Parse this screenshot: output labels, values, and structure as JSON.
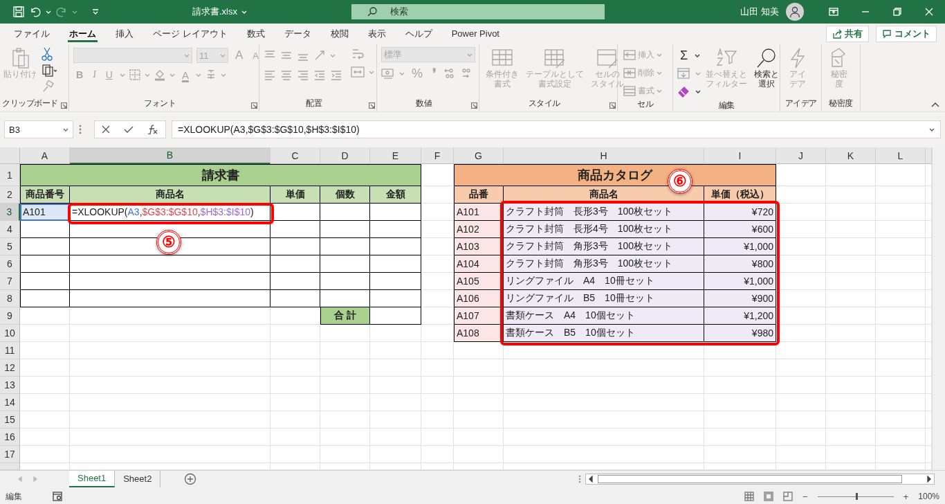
{
  "title_bar": {
    "file_name": "請求書.xlsx",
    "search": {
      "placeholder": "検索"
    },
    "user": "山田 知美"
  },
  "ribbon_tabs": [
    {
      "label": "ファイル",
      "selected": false
    },
    {
      "label": "ホーム",
      "selected": true
    },
    {
      "label": "挿入",
      "selected": false
    },
    {
      "label": "ページ レイアウト",
      "selected": false
    },
    {
      "label": "数式",
      "selected": false
    },
    {
      "label": "データ",
      "selected": false
    },
    {
      "label": "校閲",
      "selected": false
    },
    {
      "label": "表示",
      "selected": false
    },
    {
      "label": "ヘルプ",
      "selected": false
    },
    {
      "label": "Power Pivot",
      "selected": false
    }
  ],
  "share_button": "共有",
  "comment_button": "コメント",
  "ribbon_groups": [
    {
      "kind": "clipboard",
      "label": "クリップボード",
      "buttons": [
        {
          "label_lines": [
            "貼り付け"
          ],
          "disabled": true
        }
      ]
    },
    {
      "kind": "font",
      "label": "フォント",
      "size": "11",
      "buttons": [
        {
          "label": "A",
          "disabled": true
        },
        {
          "label": "A",
          "disabled": true
        },
        {
          "label": "B",
          "disabled": true
        },
        {
          "label": "I",
          "disabled": true
        },
        {
          "label": "U",
          "disabled": true
        },
        {
          "label": "A",
          "disabled": true
        }
      ]
    },
    {
      "kind": "alignment",
      "label": "配置"
    },
    {
      "kind": "number",
      "label": "数値",
      "format": "標準",
      "buttons": [
        {
          "label": "%",
          "disabled": true
        },
        {
          "label": "❜",
          "disabled": true
        }
      ]
    },
    {
      "kind": "styles",
      "label": "スタイル",
      "buttons": [
        {
          "label_lines": [
            "条件付き",
            "書式"
          ],
          "disabled": true
        },
        {
          "label_lines": [
            "テーブルとして",
            "書式設定"
          ],
          "disabled": true
        },
        {
          "label_lines": [
            "セルの",
            "スタイル"
          ],
          "disabled": true
        }
      ]
    },
    {
      "kind": "cells",
      "label": "セル",
      "buttons": [
        {
          "label": "挿入",
          "disabled": true
        },
        {
          "label": "削除",
          "disabled": true
        },
        {
          "label": "書式",
          "disabled": true
        }
      ]
    },
    {
      "kind": "editing",
      "label": "編集",
      "buttons": [
        {
          "label": "Σ",
          "disabled": false
        },
        {
          "label_lines": [
            "並べ替えと",
            "フィルター"
          ],
          "disabled": true
        },
        {
          "label_lines": [
            "検索と",
            "選択"
          ],
          "disabled": false
        }
      ]
    },
    {
      "kind": "ideas",
      "label": "アイデア",
      "buttons": [
        {
          "label_lines": [
            "アイ",
            "デア"
          ],
          "disabled": true
        }
      ]
    },
    {
      "kind": "sensitivity",
      "label": "秘密度",
      "buttons": [
        {
          "label_lines": [
            "秘密",
            "度"
          ],
          "disabled": true
        }
      ]
    }
  ],
  "formula_bar": {
    "name_box": "B3",
    "formula": "=XLOOKUP(A3,$G$3:$G$10,$H$3:$I$10)"
  },
  "sheet": {
    "columns": [
      {
        "label": "A",
        "selected": false
      },
      {
        "label": "B",
        "selected": true
      },
      {
        "label": "C",
        "selected": false
      },
      {
        "label": "D",
        "selected": false
      },
      {
        "label": "E",
        "selected": false
      },
      {
        "label": "F",
        "selected": false
      },
      {
        "label": "G",
        "selected": false
      },
      {
        "label": "H",
        "selected": false
      },
      {
        "label": "I",
        "selected": false
      },
      {
        "label": "J",
        "selected": false
      },
      {
        "label": "K",
        "selected": false
      },
      {
        "label": "L",
        "selected": false
      }
    ],
    "rows": [
      {
        "label": "1",
        "selected": false
      },
      {
        "label": "2",
        "selected": false
      },
      {
        "label": "3",
        "selected": true
      },
      {
        "label": "4",
        "selected": false
      },
      {
        "label": "5",
        "selected": false
      },
      {
        "label": "6",
        "selected": false
      },
      {
        "label": "7",
        "selected": false
      },
      {
        "label": "8",
        "selected": false
      },
      {
        "label": "9",
        "selected": false
      },
      {
        "label": "10",
        "selected": false
      },
      {
        "label": "11",
        "selected": false
      },
      {
        "label": "12",
        "selected": false
      },
      {
        "label": "13",
        "selected": false
      },
      {
        "label": "14",
        "selected": false
      },
      {
        "label": "15",
        "selected": false
      },
      {
        "label": "16",
        "selected": false
      },
      {
        "label": "17",
        "selected": false
      }
    ],
    "invoice": {
      "title": "請求書",
      "headers": [
        "商品番号",
        "商品名",
        "単価",
        "個数",
        "金額"
      ],
      "item_code": "A101",
      "formula_parts": [
        {
          "text": "=XLOOKUP("
        },
        {
          "text": "A3",
          "color": "#4472c4"
        },
        {
          "text": ","
        },
        {
          "text": "$G$3:$G$10",
          "color": "#e0474c"
        },
        {
          "text": ","
        },
        {
          "text": "$H$3:$I$10",
          "color": "#9b6bd3"
        },
        {
          "text": ")"
        }
      ],
      "total_label": "合 計"
    },
    "catalog": {
      "title": "商品カタログ",
      "headers": [
        "品番",
        "商品名",
        "単価（税込）"
      ],
      "items": [
        {
          "code": "A101",
          "name": "クラフト封筒　長形3号　100枚セット",
          "price": "¥720"
        },
        {
          "code": "A102",
          "name": "クラフト封筒　長形4号　100枚セット",
          "price": "¥600"
        },
        {
          "code": "A103",
          "name": "クラフト封筒　角形3号　100枚セット",
          "price": "¥1,000"
        },
        {
          "code": "A104",
          "name": "クラフト封筒　角形3号　100枚セット",
          "price": "¥800"
        },
        {
          "code": "A105",
          "name": "リングファイル　A4　10冊セット",
          "price": "¥1,000"
        },
        {
          "code": "A106",
          "name": "リングファイル　B5　10冊セット",
          "price": "¥900"
        },
        {
          "code": "A107",
          "name": "書類ケース　A4　10個セット",
          "price": "¥1,200"
        },
        {
          "code": "A108",
          "name": "書類ケース　B5　10個セット",
          "price": "¥980"
        }
      ]
    }
  },
  "annotations": [
    {
      "label": "⑤"
    },
    {
      "label": "⑥"
    }
  ],
  "sheet_tabs": [
    {
      "label": "Sheet1",
      "selected": true
    },
    {
      "label": "Sheet2",
      "selected": false
    }
  ],
  "status_bar": {
    "mode": "編集",
    "zoom_out": "−",
    "zoom_in": "+",
    "zoom": "100%",
    "zoom_slider": {
      "level": 0.5
    }
  }
}
